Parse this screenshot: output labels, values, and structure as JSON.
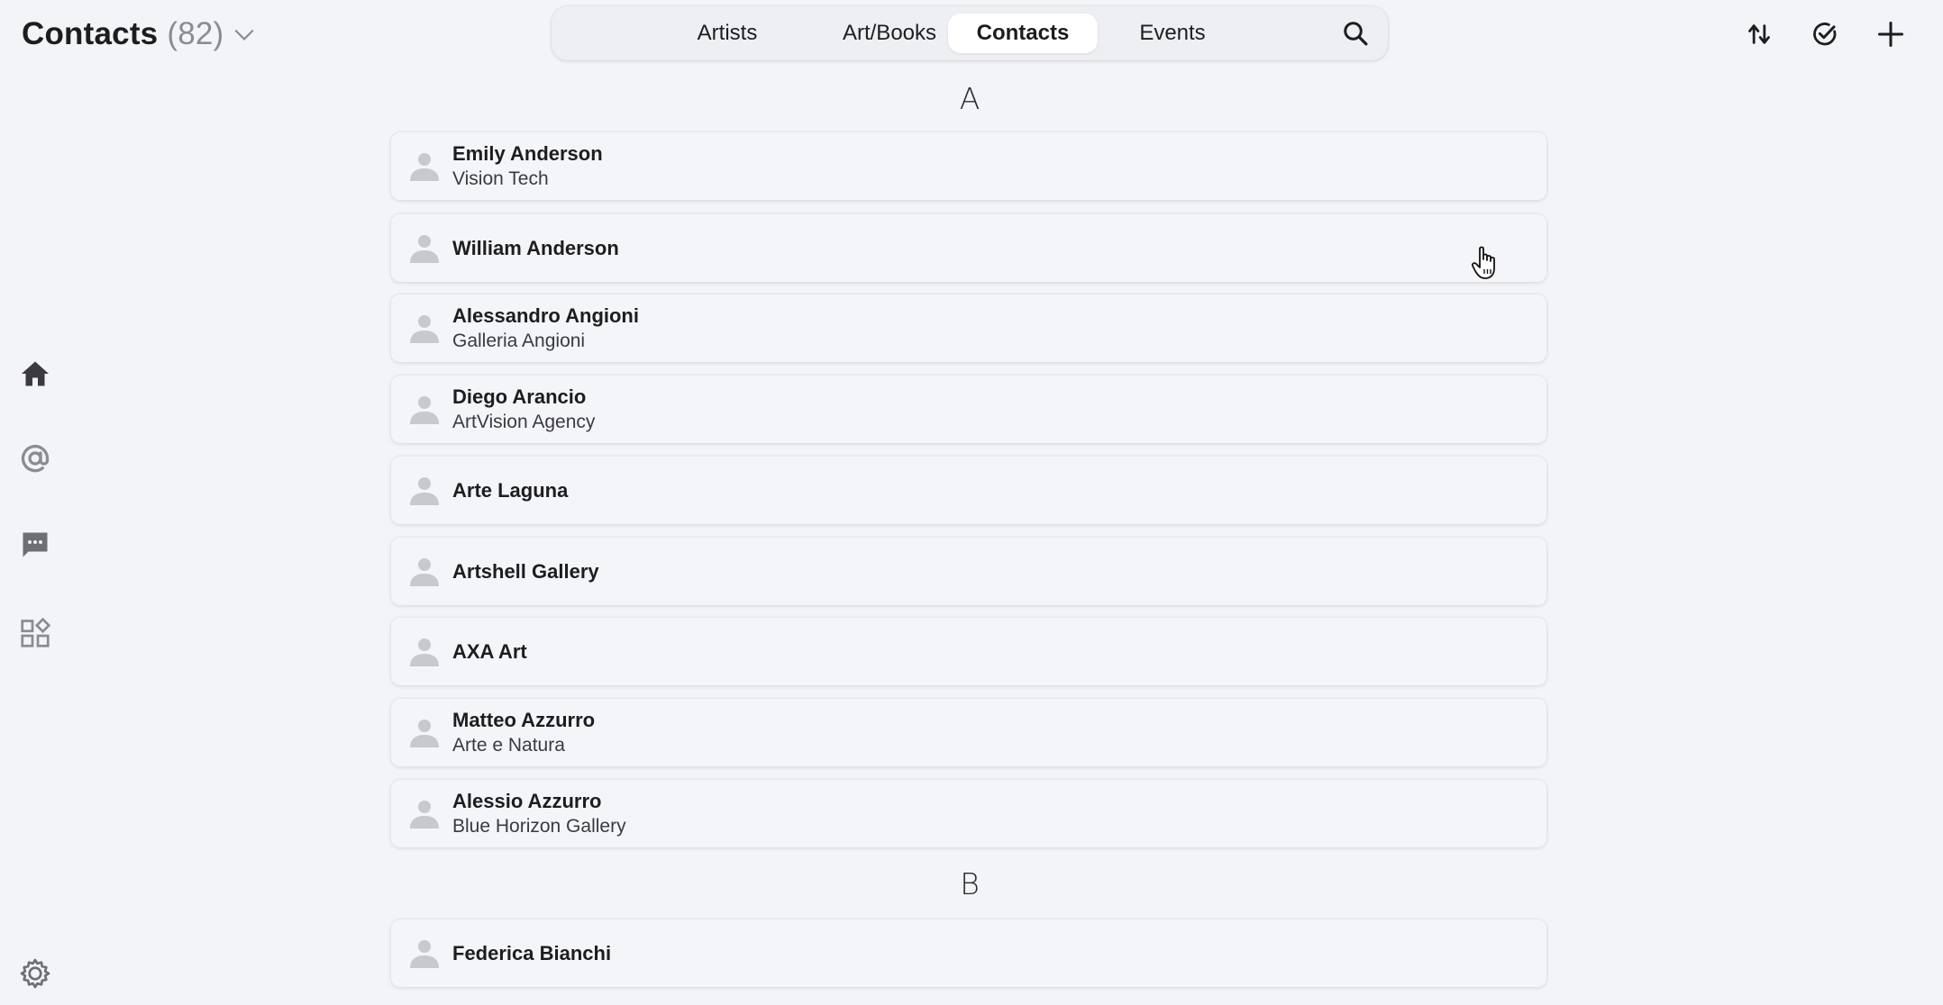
{
  "header": {
    "title": "Contacts",
    "count": "(82)"
  },
  "tabs": [
    {
      "label": "Artists",
      "active": false
    },
    {
      "label": "Art/Books",
      "active": false
    },
    {
      "label": "Contacts",
      "active": true
    },
    {
      "label": "Events",
      "active": false
    }
  ],
  "top_actions": [
    "sort-icon",
    "check-circle-icon",
    "plus-icon"
  ],
  "sidebar": [
    "home-icon",
    "at-sign-icon",
    "chat-bubble-icon",
    "widgets-icon",
    "gear-icon"
  ],
  "sections": [
    {
      "letter": "A",
      "contacts": [
        {
          "name": "Emily Anderson",
          "company": "Vision Tech"
        },
        {
          "name": "William Anderson",
          "company": ""
        },
        {
          "name": "Alessandro Angioni",
          "company": "Galleria Angioni"
        },
        {
          "name": "Diego Arancio",
          "company": "ArtVision Agency"
        },
        {
          "name": "Arte Laguna",
          "company": ""
        },
        {
          "name": "Artshell Gallery",
          "company": ""
        },
        {
          "name": "AXA Art",
          "company": ""
        },
        {
          "name": "Matteo Azzurro",
          "company": "Arte e Natura"
        },
        {
          "name": "Alessio Azzurro",
          "company": "Blue Horizon Gallery"
        }
      ]
    },
    {
      "letter": "B",
      "contacts": [
        {
          "name": "Federica Bianchi",
          "company": ""
        }
      ]
    }
  ],
  "colors": {
    "background": "#f3f4f8",
    "row": "#f4f5f9",
    "accent_text": "#1d1d20",
    "muted": "#8b8b92"
  }
}
